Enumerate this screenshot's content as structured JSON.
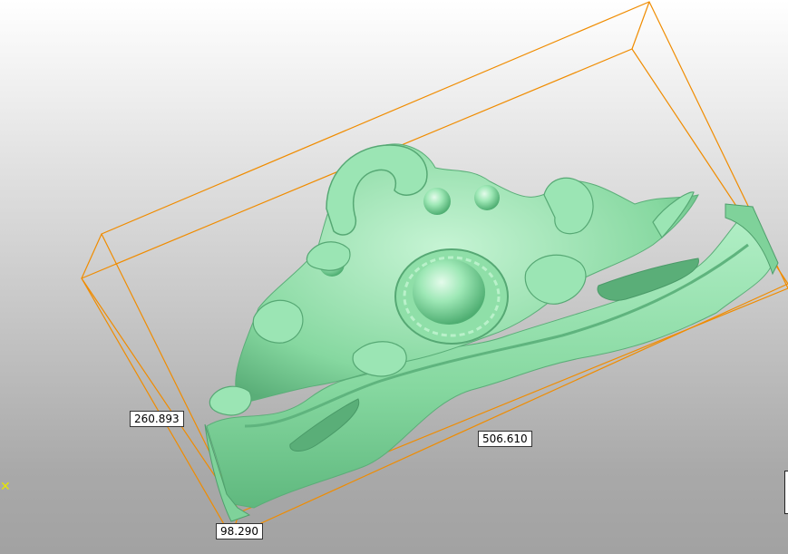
{
  "viewport": {
    "title": "",
    "background": {
      "top": "#ffffff",
      "bottom": "#a2a2a2"
    },
    "bounding_box_color": "#f08c00",
    "model_color": "#8fe3a8",
    "model_shadow_color": "#5fbf80",
    "model_highlight_color": "#c8f5d6",
    "model_description": "carved ornamental baroque relief panel"
  },
  "dimensions": {
    "height": "260.893",
    "length": "506.610",
    "depth": "98.290"
  },
  "axis_gizmo": {
    "icon": "axis-cross-icon",
    "glyph": "✕",
    "color": "#e6e600"
  }
}
